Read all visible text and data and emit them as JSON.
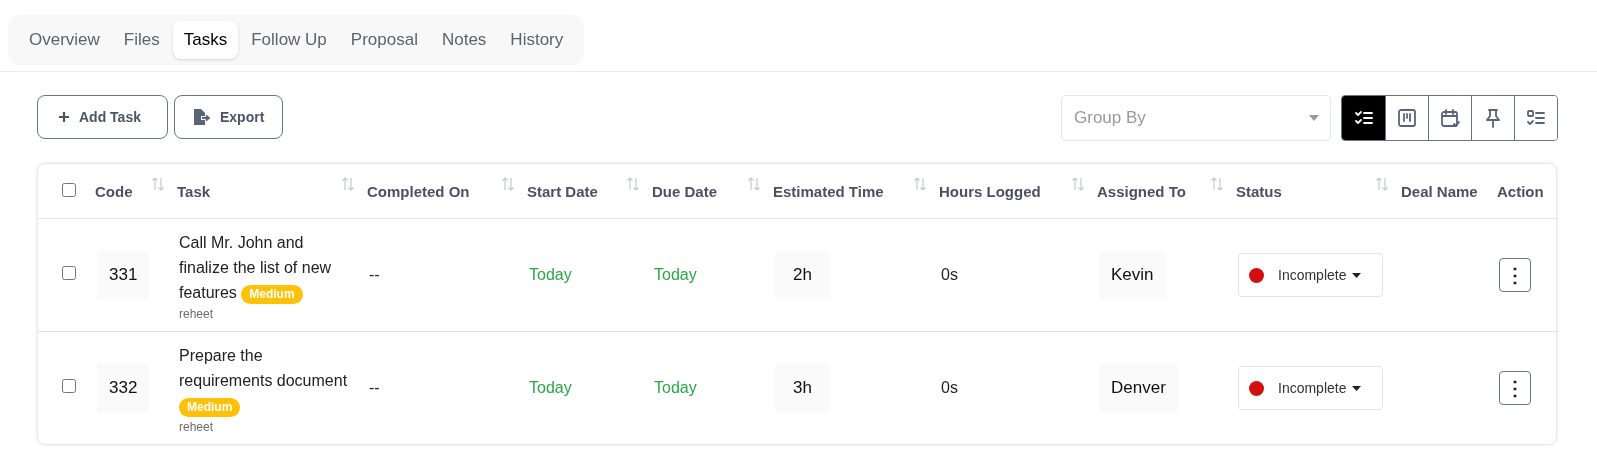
{
  "tabs": [
    {
      "label": "Overview",
      "selected": false
    },
    {
      "label": "Files",
      "selected": false
    },
    {
      "label": "Tasks",
      "selected": true
    },
    {
      "label": "Follow Up",
      "selected": false
    },
    {
      "label": "Proposal",
      "selected": false
    },
    {
      "label": "Notes",
      "selected": false
    },
    {
      "label": "History",
      "selected": false
    }
  ],
  "toolbar": {
    "buttons": [
      {
        "kind": "add",
        "label": "Add Task"
      },
      {
        "kind": "export",
        "label": "Export"
      }
    ],
    "group_by": {
      "placeholder": "Group By"
    },
    "views": [
      {
        "kind": "list",
        "selected": true
      },
      {
        "kind": "board",
        "selected": false
      },
      {
        "kind": "calendar",
        "selected": false
      },
      {
        "kind": "pinned",
        "selected": false
      },
      {
        "kind": "checklist",
        "selected": false
      }
    ]
  },
  "table": {
    "select_all": {
      "checked": false
    },
    "columns": [
      {
        "label": "Code",
        "sortable": true
      },
      {
        "label": "Task",
        "sortable": true
      },
      {
        "label": "Completed On",
        "sortable": true
      },
      {
        "label": "Start Date",
        "sortable": true
      },
      {
        "label": "Due Date",
        "sortable": true
      },
      {
        "label": "Estimated Time",
        "sortable": true
      },
      {
        "label": "Hours Logged",
        "sortable": true
      },
      {
        "label": "Assigned To",
        "sortable": true
      },
      {
        "label": "Status",
        "sortable": true
      },
      {
        "label": "Deal Name",
        "sortable": false
      },
      {
        "label": "Action",
        "sortable": false
      }
    ],
    "rows": [
      {
        "checked": false,
        "code": "331",
        "task": "Call Mr. John and finalize the list of new features",
        "priority": "Medium",
        "project": "reheet",
        "completed_on": "--",
        "start_date": "Today",
        "due_date": "Today",
        "estimated_time": "2h",
        "hours_logged": "0s",
        "assigned_to": "Kevin",
        "status": {
          "label": "Incomplete",
          "color": "#d21010"
        },
        "action": "⋮"
      },
      {
        "checked": false,
        "code": "332",
        "task": "Prepare the requirements document",
        "priority": "Medium",
        "project": "reheet",
        "completed_on": "--",
        "start_date": "Today",
        "due_date": "Today",
        "estimated_time": "3h",
        "hours_logged": "0s",
        "assigned_to": "Denver",
        "status": {
          "label": "Incomplete",
          "color": "#d21010"
        },
        "action": "⋮"
      }
    ]
  }
}
